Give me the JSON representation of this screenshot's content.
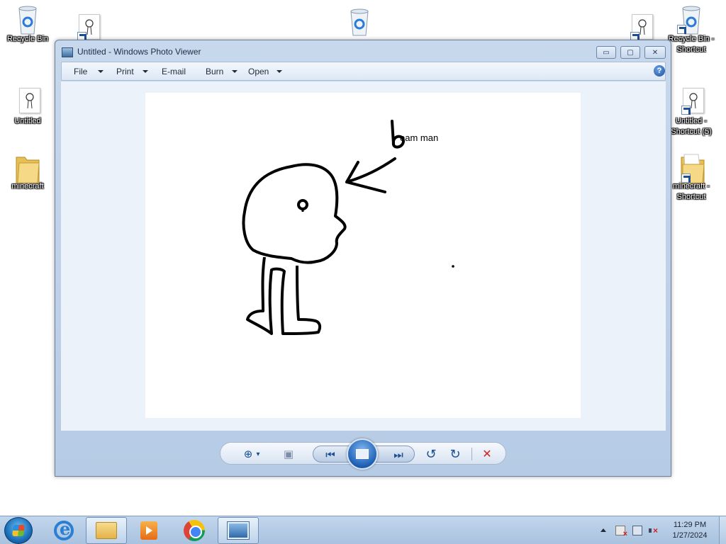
{
  "desktop": {
    "icons": [
      {
        "label": "Recycle Bin",
        "icon": "recycle-bin-icon"
      },
      {
        "label": "",
        "icon": "paint-document-shortcut-icon"
      },
      {
        "label": "",
        "icon": "recycle-bin-icon"
      },
      {
        "label": "Untitled",
        "icon": "paint-document-icon"
      },
      {
        "label": "minecraft",
        "icon": "folder-icon"
      },
      {
        "label": "",
        "icon": "paint-document-shortcut-icon"
      },
      {
        "label": "Recycle Bin - Shortcut",
        "icon": "recycle-bin-shortcut-icon"
      },
      {
        "label": "Untitled - Shortcut (5)",
        "icon": "paint-document-shortcut-icon"
      },
      {
        "label": "minecraft - Shortcut",
        "icon": "folder-shortcut-icon"
      }
    ]
  },
  "window": {
    "title": "Untitled - Windows Photo Viewer",
    "controls": {
      "minimize": "▭",
      "maximize": "▢",
      "close": "✕"
    },
    "menu": [
      {
        "label": "File",
        "has_dropdown": true
      },
      {
        "label": "Print",
        "has_dropdown": true
      },
      {
        "label": "E-mail",
        "has_dropdown": false
      },
      {
        "label": "Burn",
        "has_dropdown": true
      },
      {
        "label": "Open",
        "has_dropdown": true
      }
    ],
    "help": "?",
    "photo": {
      "caption_text": "eam man",
      "drawing": "stick figure with arrow pointing at head and letter b"
    },
    "controls_bar": {
      "zoom": "⊕",
      "zoom_caret": "▾",
      "fit": "▣",
      "previous": "⏮",
      "next": "⏭",
      "rotate_ccw": "↺",
      "rotate_cw": "↻",
      "delete": "✕"
    }
  },
  "taskbar": {
    "items": [
      "internet-explorer",
      "file-explorer",
      "media-player",
      "chrome",
      "photo-viewer"
    ],
    "active_item": "photo-viewer",
    "clock": {
      "time": "11:29 PM",
      "date": "1/27/2024"
    }
  },
  "colors": {
    "window_frame": "#b6cbe5",
    "view_background": "#ecf2fa",
    "delete_red": "#d1221d",
    "accent_blue": "#1b4f94"
  }
}
